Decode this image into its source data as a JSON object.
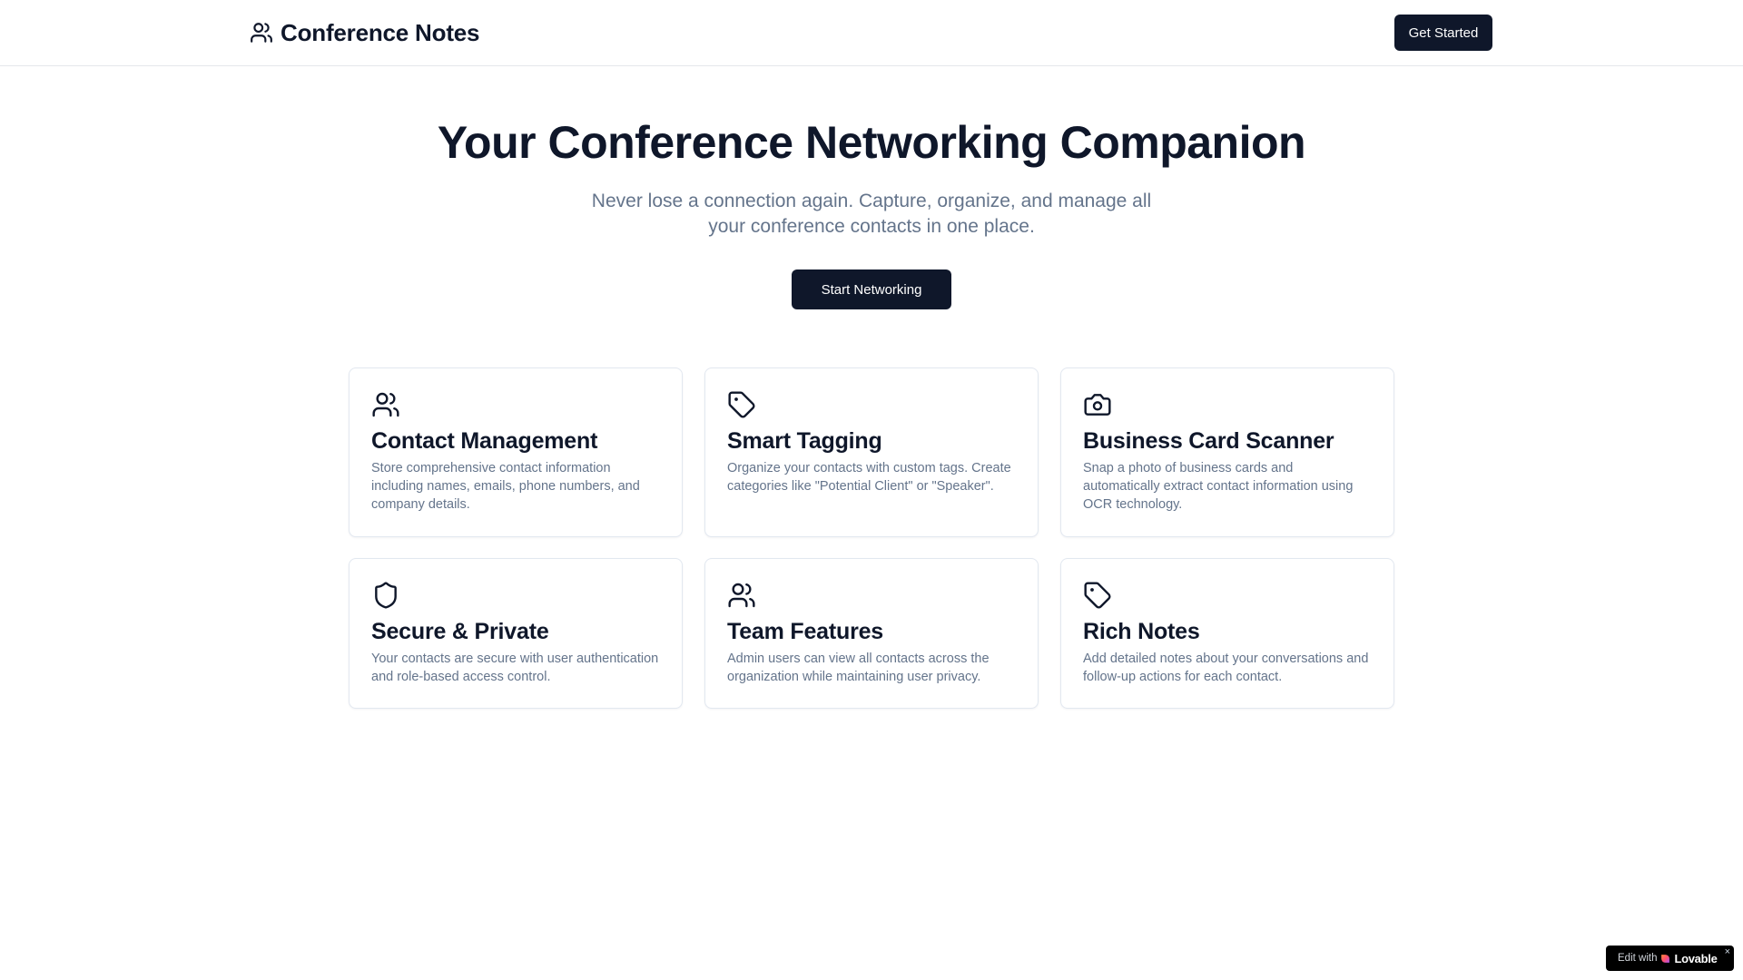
{
  "header": {
    "brand_icon": "users-icon",
    "brand_title": "Conference Notes",
    "cta_label": "Get Started"
  },
  "hero": {
    "title": "Your Conference Networking Companion",
    "subtitle": "Never lose a connection again. Capture, organize, and manage all your conference contacts in one place.",
    "cta_label": "Start Networking"
  },
  "features": [
    {
      "icon": "users-icon",
      "title": "Contact Management",
      "description": "Store comprehensive contact information including names, emails, phone numbers, and company details."
    },
    {
      "icon": "tag-icon",
      "title": "Smart Tagging",
      "description": "Organize your contacts with custom tags. Create categories like \"Potential Client\" or \"Speaker\"."
    },
    {
      "icon": "camera-icon",
      "title": "Business Card Scanner",
      "description": "Snap a photo of business cards and automatically extract contact information using OCR technology."
    },
    {
      "icon": "shield-icon",
      "title": "Secure & Private",
      "description": "Your contacts are secure with user authentication and role-based access control."
    },
    {
      "icon": "users-icon",
      "title": "Team Features",
      "description": "Admin users can view all contacts across the organization while maintaining user privacy."
    },
    {
      "icon": "tag-icon",
      "title": "Rich Notes",
      "description": "Add detailed notes about your conversations and follow-up actions for each contact."
    }
  ],
  "badge": {
    "prefix": "Edit with",
    "brand": "Lovable",
    "close": "×"
  },
  "colors": {
    "primary": "#0f172a",
    "muted_text": "#64748b",
    "border": "#e2e8f0",
    "lovable_accent": "#ff4d6d"
  }
}
